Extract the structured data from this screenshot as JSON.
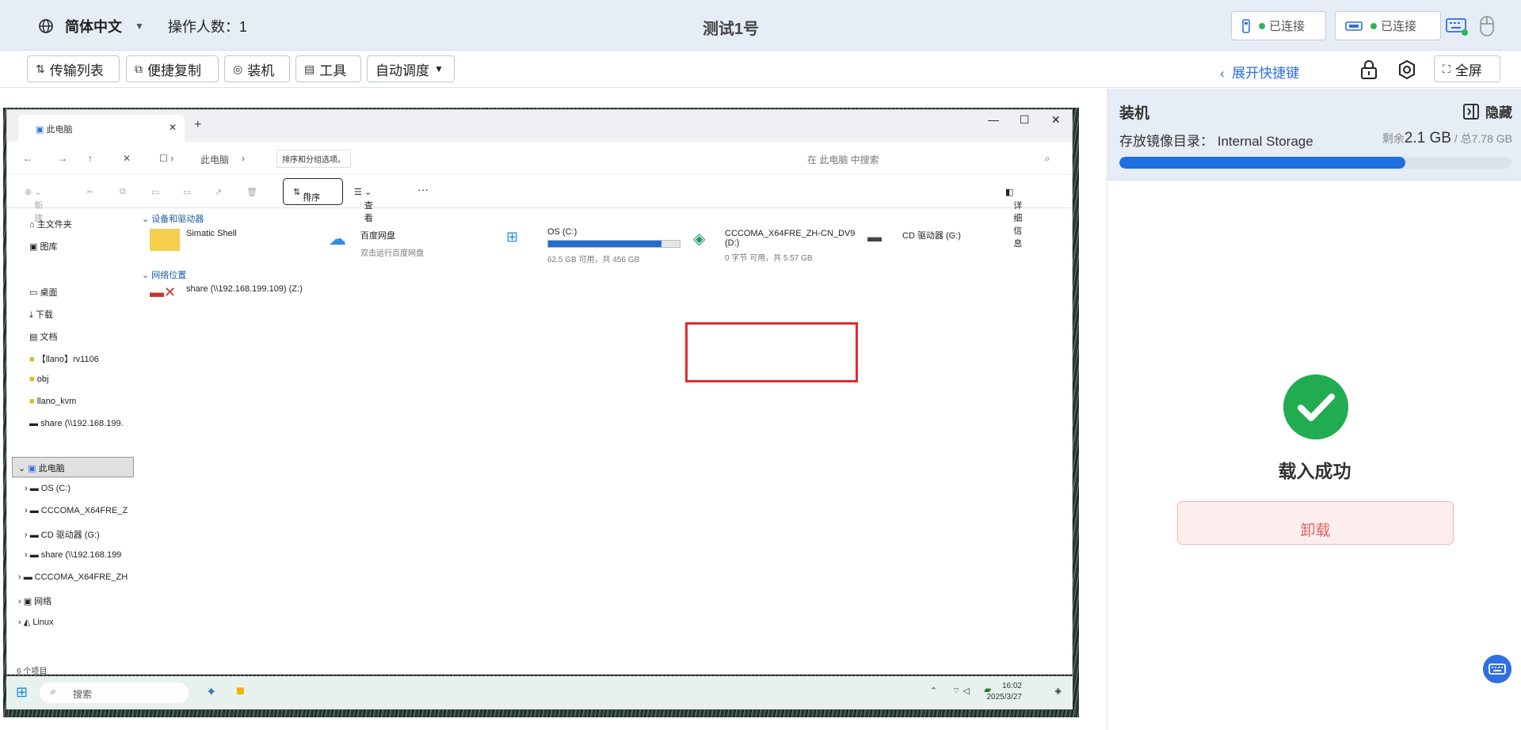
{
  "header": {
    "language": "简体中文",
    "operators": "操作人数：1",
    "title": "测试1号",
    "usb_status": "已连接",
    "display_status": "已连接"
  },
  "toolbar": {
    "transfer": "传输列表",
    "copy": "便捷复制",
    "install": "装机",
    "tools": "工具",
    "auto": "自动调度",
    "expand": "展开快捷键",
    "fullscreen": "全屏"
  },
  "explorer": {
    "tab_title": "此电脑",
    "breadcrumb": "此电脑",
    "tooltip": "排序和分组选项。",
    "search_placeholder": "在 此电脑 中搜索",
    "cmd": {
      "new": "新建",
      "sort": "排序",
      "view": "查看",
      "more": "···",
      "details": "详细信息"
    },
    "nav": {
      "home": "主文件夹",
      "gallery": "图库",
      "desktop": "桌面",
      "downloads": "下载",
      "documents": "文档",
      "folder_rv": "【llano】rv1106",
      "folder_obj": "obj",
      "folder_kvm": "llano_kvm",
      "share": "share (\\\\192.168.199.",
      "this_pc": "此电脑",
      "os": "OS (C:)",
      "cccoma": "CCCOMA_X64FRE_Z",
      "cd": "CD 驱动器 (G:)",
      "share2": "share (\\\\192.168.199",
      "cccoma2": "CCCOMA_X64FRE_ZH",
      "network": "网络",
      "linux": "Linux"
    },
    "groups": {
      "devices": "设备和驱动器",
      "network": "网络位置"
    },
    "drives": {
      "simatic": "Simatic Shell",
      "baidu": "百度网盘",
      "baidu_sub": "双击运行百度网盘",
      "os": "OS (C:)",
      "os_sub": "62.5 GB 可用，共 456 GB",
      "os_used": 0.86,
      "cccoma": "CCCOMA_X64FRE_ZH-CN_DV9",
      "cccoma_letter": "(D:)",
      "cccoma_sub": "0 字节 可用，共 5.57 GB",
      "cd": "CD 驱动器 (G:)",
      "share": "share (\\\\192.168.199.109) (Z:)"
    },
    "status": "6 个项目"
  },
  "taskbar": {
    "search": "搜索",
    "time": "16:02",
    "date": "2025/3/27"
  },
  "panel": {
    "title": "装机",
    "hide": "隐藏",
    "storage_label": "存放镜像目录：",
    "storage_value": "Internal Storage",
    "remain_label": "剩余",
    "remain_value": "2.1 GB",
    "total": " / 总7.78 GB",
    "used_fraction": 0.73,
    "success": "载入成功",
    "unload": "卸载"
  },
  "colors": {
    "accent": "#1e6fe0",
    "success": "#22ac52",
    "danger": "#e86060",
    "highlight": "#e12b2b"
  }
}
